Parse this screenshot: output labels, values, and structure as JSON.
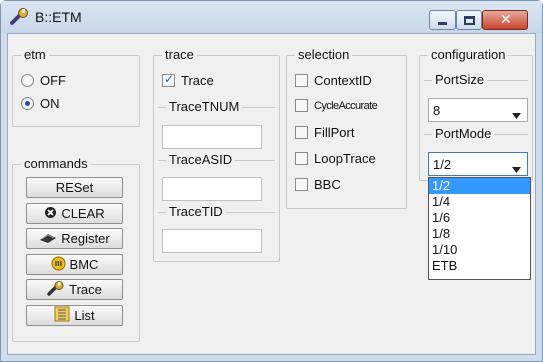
{
  "window": {
    "title": "B::ETM",
    "title_icon": "wrench-icon",
    "buttons": [
      "minimize-icon",
      "maximize-icon",
      "close-icon"
    ]
  },
  "etm": {
    "title": "etm",
    "options": [
      {
        "label": "OFF",
        "selected": false
      },
      {
        "label": "ON",
        "selected": true
      }
    ]
  },
  "trace": {
    "title": "trace",
    "checkbox": {
      "label": "Trace",
      "checked": true
    },
    "fields": [
      {
        "label": "TraceTNUM",
        "value": ""
      },
      {
        "label": "TraceASID",
        "value": ""
      },
      {
        "label": "TraceTID",
        "value": ""
      }
    ]
  },
  "selection": {
    "title": "selection",
    "items": [
      {
        "label": "ContextID",
        "checked": false
      },
      {
        "label": "CycleAccurate",
        "checked": false
      },
      {
        "label": "FillPort",
        "checked": false
      },
      {
        "label": "LoopTrace",
        "checked": false
      },
      {
        "label": "BBC",
        "checked": false
      }
    ]
  },
  "configuration": {
    "title": "configuration",
    "port_size": {
      "label": "PortSize",
      "value": "8"
    },
    "port_mode": {
      "label": "PortMode",
      "value": "1/2",
      "options": [
        "1/2",
        "1/4",
        "1/6",
        "1/8",
        "1/10",
        "ETB"
      ],
      "highlighted": "1/2"
    }
  },
  "commands": {
    "title": "commands",
    "buttons": [
      {
        "label": "RESet",
        "icon": ""
      },
      {
        "label": "CLEAR",
        "icon": "clear-icon"
      },
      {
        "label": "Register",
        "icon": "chip-icon"
      },
      {
        "label": "BMC",
        "icon": "bmc-icon"
      },
      {
        "label": "Trace",
        "icon": "wrench-icon"
      },
      {
        "label": "List",
        "icon": "list-icon"
      }
    ]
  },
  "colors": {
    "accent": "#3399ff",
    "window_frame": "#cfdcec",
    "close_button": "#c8452e"
  }
}
